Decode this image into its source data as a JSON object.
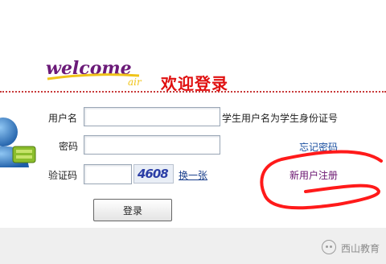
{
  "brand": {
    "logo_word": "welcome",
    "logo_sub": "air",
    "title": "欢迎登录"
  },
  "form": {
    "username_label": "用户名",
    "username_value": "",
    "username_hint": "学生用户名为学生身份证号",
    "password_label": "密码",
    "password_value": "",
    "forgot_link": "忘记密码",
    "captcha_label": "验证码",
    "captcha_value": "",
    "captcha_text": "4608",
    "refresh_link": "换一张",
    "register_link": "新用户注册",
    "login_button": "登录"
  },
  "watermark": {
    "text": "西山教育"
  },
  "colors": {
    "title": "#e01010",
    "divider": "#c83a3a",
    "annotation_circle": "#ff1a1a",
    "logo_purple": "#6b1a78",
    "logo_yellow": "#f0c419"
  },
  "icons": {
    "avatar": "user-avatar-icon",
    "watermark": "wechat-icon"
  }
}
